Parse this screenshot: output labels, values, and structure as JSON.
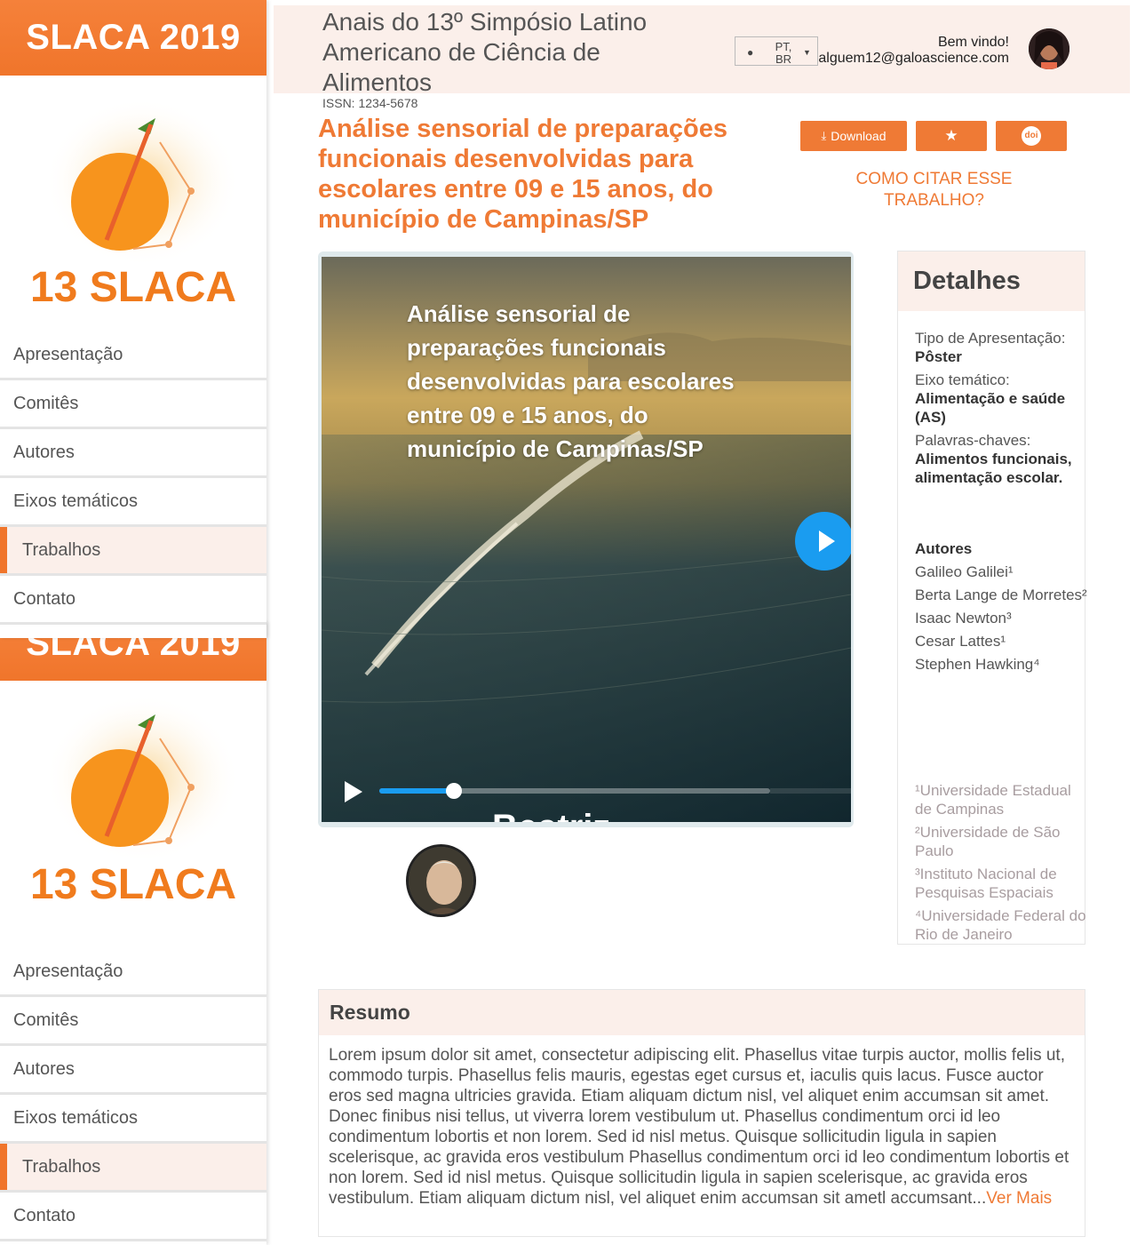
{
  "sidebar": {
    "brand": "SLACA 2019",
    "logo_text": "13 SLACA",
    "menu": [
      {
        "label": "Apresentação",
        "active": false
      },
      {
        "label": "Comitês",
        "active": false
      },
      {
        "label": "Autores",
        "active": false
      },
      {
        "label": "Eixos temáticos",
        "active": false
      },
      {
        "label": "Trabalhos",
        "active": true
      },
      {
        "label": "Contato",
        "active": false
      }
    ]
  },
  "header": {
    "conference_title": "Anais do 13º Simpósio Latino Americano de Ciência de Alimentos",
    "issn": "ISSN: 1234-5678",
    "language": "PT, BR",
    "welcome": "Bem vindo!",
    "email": "alguem12@galoascience.com"
  },
  "paper": {
    "title": "Análise sensorial de preparações funcionais desenvolvidas para escolares entre 09 e 15 anos, do município de Campinas/SP",
    "download_label": "Download",
    "cite_label": "COMO CITAR ESSE TRABALHO?"
  },
  "video": {
    "title": "Análise sensorial de preparações funcionais desenvolvidas para escolares entre 09 e 15 anos, do município de Campinas/SP",
    "cut_name": "Beatriz",
    "progress": 0.19
  },
  "details": {
    "heading": "Detalhes",
    "presentation_label": "Tipo de Apresentação:",
    "presentation_value": "Pôster",
    "axis_label": "Eixo temático:",
    "axis_value": "Alimentação e saúde (AS)",
    "keywords_label": "Palavras-chaves:",
    "keywords_value": "Alimentos funcionais, alimentação escolar.",
    "authors_heading": "Autores",
    "authors": [
      "Galileo Galilei¹",
      "Berta Lange de Morretes²",
      "Isaac Newton³",
      "Cesar Lattes¹",
      "Stephen Hawking⁴"
    ],
    "affiliations": [
      "¹Universidade Estadual de Campinas",
      "²Universidade de São Paulo",
      "³Instituto Nacional de Pesquisas Espaciais",
      "⁴Universidade Federal do Rio de Janeiro"
    ]
  },
  "resumo": {
    "heading": "Resumo",
    "text": "Lorem ipsum dolor sit amet, consectetur adipiscing elit. Phasellus vitae turpis auctor, mollis felis ut, commodo turpis. Phasellus felis mauris, egestas eget cursus et, iaculis quis lacus. Fusce auctor eros sed magna ultricies gravida. Etiam aliquam dictum nisl, vel aliquet enim accumsan sit amet. Donec finibus nisi tellus, ut viverra lorem vestibulum ut. Phasellus condimentum orci id leo condimentum lobortis et non lorem. Sed id nisl metus. Quisque sollicitudin ligula in sapien scelerisque, ac gravida eros vestibulum Phasellus condimentum orci id leo condimentum lobortis et non lorem. Sed id nisl metus. Quisque sollicitudin ligula in sapien scelerisque, ac gravida eros vestibulum. Etiam aliquam dictum nisl, vel aliquet enim accumsan sit ametl accumsant...",
    "more_label": "Ver Mais"
  },
  "icons": {
    "globe": "globe-icon",
    "caret": "caret-down-icon",
    "download": "download-icon",
    "star": "star-icon",
    "doi": "doi-icon",
    "play": "play-icon"
  },
  "colors": {
    "accent": "#ef7a35",
    "header_bg": "#fbefea",
    "video_play": "#1a9cf0"
  }
}
